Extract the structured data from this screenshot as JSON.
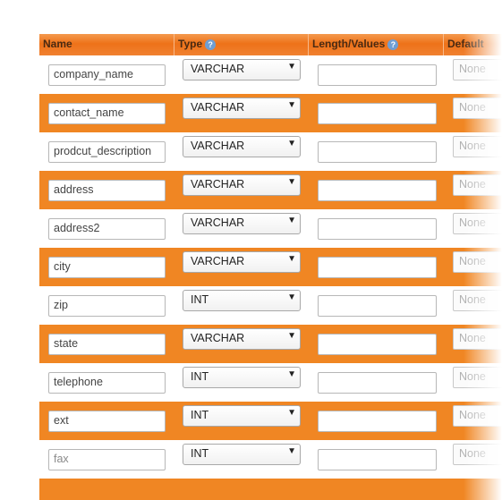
{
  "headers": {
    "name": "Name",
    "type": "Type",
    "length_values": "Length/Values",
    "default": "Default"
  },
  "icons": {
    "help": "help-icon",
    "dropdown": "chevron-down-icon"
  },
  "colors": {
    "accent": "#f08623",
    "header": "#ee7219",
    "help_icon": "#6f9ed3"
  },
  "rows": [
    {
      "name": "company_name",
      "type": "VARCHAR",
      "length": "",
      "default": "None"
    },
    {
      "name": "contact_name",
      "type": "VARCHAR",
      "length": "",
      "default": "None"
    },
    {
      "name": "prodcut_description",
      "type": "VARCHAR",
      "length": "",
      "default": "None"
    },
    {
      "name": "address",
      "type": "VARCHAR",
      "length": "",
      "default": "None"
    },
    {
      "name": "address2",
      "type": "VARCHAR",
      "length": "",
      "default": "None"
    },
    {
      "name": "city",
      "type": "VARCHAR",
      "length": "",
      "default": "None"
    },
    {
      "name": "zip",
      "type": "INT",
      "length": "",
      "default": "None"
    },
    {
      "name": "state",
      "type": "VARCHAR",
      "length": "",
      "default": "None"
    },
    {
      "name": "telephone",
      "type": "INT",
      "length": "",
      "default": "None"
    },
    {
      "name": "ext",
      "type": "INT",
      "length": "",
      "default": "None"
    },
    {
      "name": "fax",
      "type": "INT",
      "length": "",
      "default": "None"
    }
  ]
}
